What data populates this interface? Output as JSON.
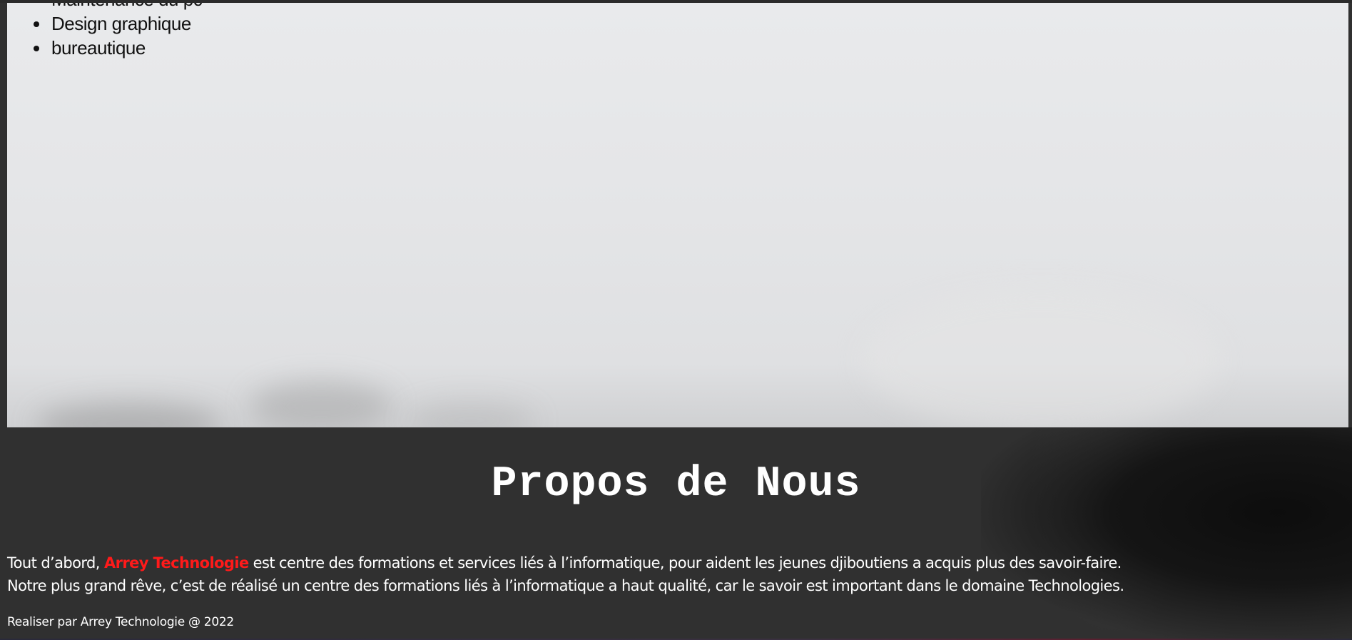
{
  "hero": {
    "services": [
      "Maintenance du pc",
      "Design graphique",
      "bureautique"
    ]
  },
  "about": {
    "title": "Propos de Nous",
    "line1_prefix": "Tout d’abord, ",
    "brand": "Arrey Technologie",
    "line1_suffix": " est centre des formations et services liés à l’informatique, pour aident les jeunes djiboutiens a acquis plus des savoir-faire.",
    "line2": "Notre plus grand rêve, c’est de réalisé un centre des formations liés à l’informatique a haut qualité, car le savoir est important dans le domaine Technologies."
  },
  "footer": {
    "text": "Realiser par Arrey Technologie @ 2022"
  },
  "colors": {
    "background": "#303030",
    "brand": "#ff1a1a",
    "hero": "#e6e7e9"
  }
}
